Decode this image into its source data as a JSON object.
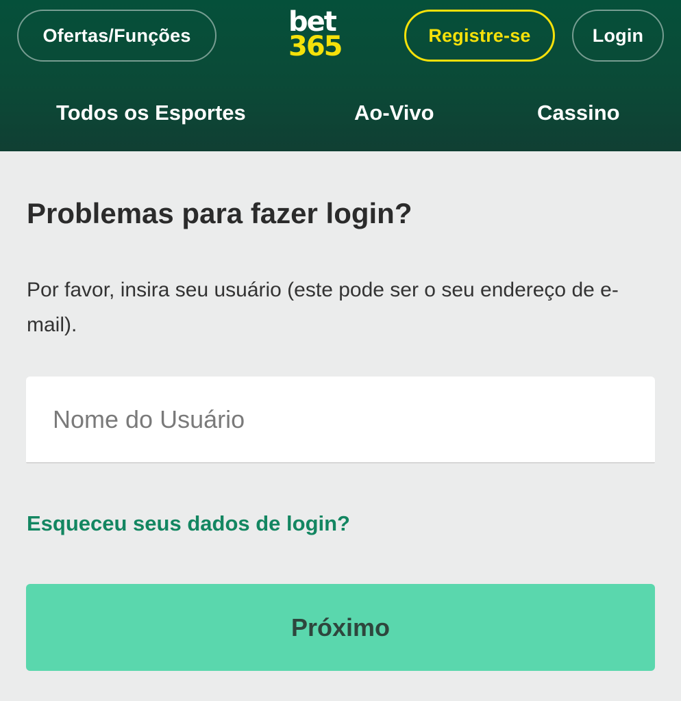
{
  "header": {
    "offers_label": "Ofertas/Funções",
    "logo_top": "bet",
    "logo_bottom": "365",
    "register_label": "Registre-se",
    "login_label": "Login",
    "nav": {
      "sports": "Todos os Esportes",
      "live": "Ao-Vivo",
      "casino": "Cassino"
    }
  },
  "main": {
    "title": "Problemas para fazer login?",
    "description": "Por favor, insira seu usuário (este pode ser o seu endereço de e-mail).",
    "username_placeholder": "Nome do Usuário",
    "username_value": "",
    "forgot_link": "Esqueceu seus dados de login?",
    "next_button": "Próximo"
  },
  "colors": {
    "header_green": "#0b4a37",
    "brand_yellow": "#f5e10a",
    "link_green": "#138661",
    "button_green": "#5ad7ad",
    "background": "#ebecec"
  }
}
